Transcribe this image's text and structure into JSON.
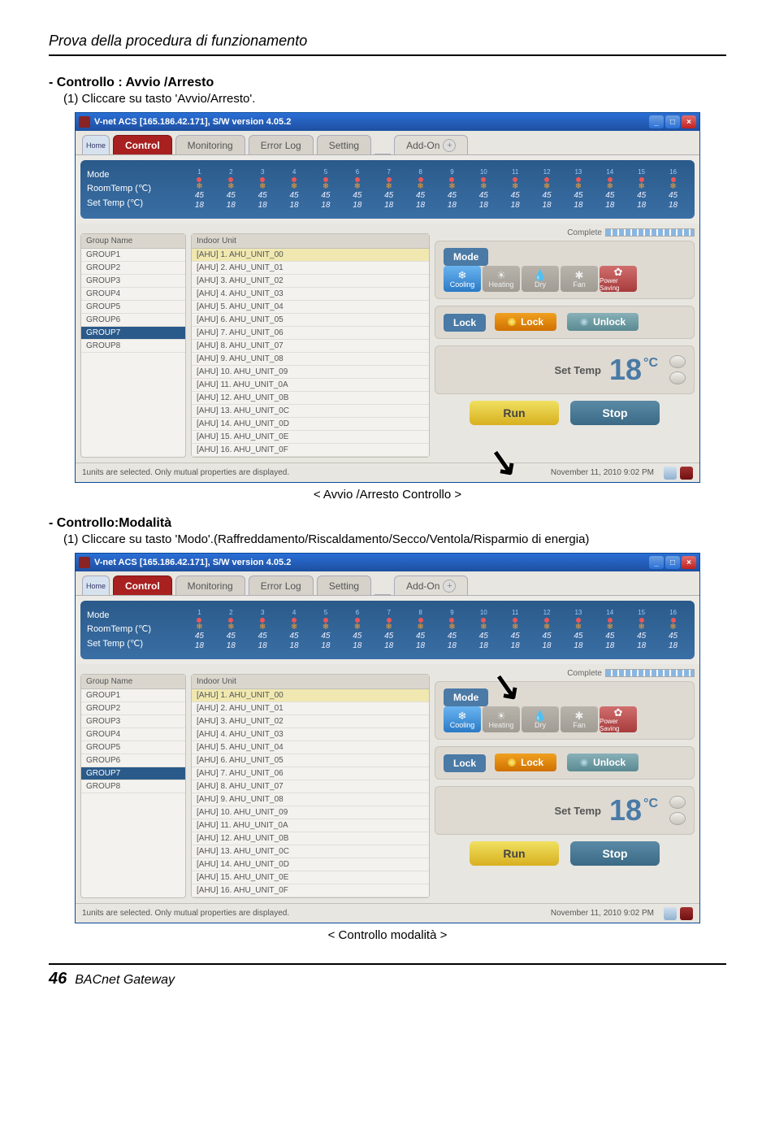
{
  "header": {
    "section": "Prova della procedura di funzionamento"
  },
  "sec1": {
    "title": "- Controllo : Avvio /Arresto",
    "step": "(1) Cliccare su tasto 'Avvio/Arresto'.",
    "caption": "< Avvio /Arresto Controllo >"
  },
  "sec2": {
    "title": "- Controllo:Modalità",
    "step": "(1) Cliccare su tasto 'Modo'.(Raffreddamento/Riscaldamento/Secco/Ventola/Risparmio di energia)",
    "caption": "< Controllo modalità >"
  },
  "win": {
    "title": "V-net ACS [165.186.42.171],   S/W version 4.05.2",
    "minimize": "_",
    "maximize": "□",
    "close": "×",
    "tabs": {
      "home": "Home",
      "control": "Control",
      "monitoring": "Monitoring",
      "errorlog": "Error Log",
      "setting": "Setting",
      "addon": "Add-On"
    },
    "hdr": {
      "mode": "Mode",
      "roomtemp": "RoomTemp (℃)",
      "settemp": "Set Temp  (℃)",
      "cols": [
        "1",
        "2",
        "3",
        "4",
        "5",
        "6",
        "7",
        "8",
        "9",
        "10",
        "11",
        "12",
        "13",
        "14",
        "15",
        "16"
      ],
      "v1": "45",
      "v2": "18"
    },
    "grouphdr": "Group Name",
    "groups": [
      "GROUP1",
      "GROUP2",
      "GROUP3",
      "GROUP4",
      "GROUP5",
      "GROUP6",
      "GROUP7",
      "GROUP8"
    ],
    "unithdr": "Indoor Unit",
    "units": [
      "[AHU] 1. AHU_UNIT_00",
      "[AHU] 2. AHU_UNIT_01",
      "[AHU] 3. AHU_UNIT_02",
      "[AHU] 4. AHU_UNIT_03",
      "[AHU] 5. AHU_UNIT_04",
      "[AHU] 6. AHU_UNIT_05",
      "[AHU] 7. AHU_UNIT_06",
      "[AHU] 8. AHU_UNIT_07",
      "[AHU] 9. AHU_UNIT_08",
      "[AHU] 10. AHU_UNIT_09",
      "[AHU] 11. AHU_UNIT_0A",
      "[AHU] 12. AHU_UNIT_0B",
      "[AHU] 13. AHU_UNIT_0C",
      "[AHU] 14. AHU_UNIT_0D",
      "[AHU] 15. AHU_UNIT_0E",
      "[AHU] 16. AHU_UNIT_0F"
    ],
    "complete": "Complete",
    "mode_label": "Mode",
    "modes": {
      "cooling": "Cooling",
      "heating": "Heating",
      "dry": "Dry",
      "fan": "Fan",
      "power": "Power Saving"
    },
    "lock_label": "Lock",
    "lock_btn": "Lock",
    "unlock_btn": "Unlock",
    "settemp_label": "Set Temp",
    "settemp_val": "18",
    "settemp_unit": "°C",
    "run": "Run",
    "stop": "Stop",
    "status_left": "1units are selected. Only mutual properties are displayed.",
    "status_right": "November 11, 2010  9:02 PM"
  },
  "footer": {
    "page": "46",
    "book": "BACnet Gateway"
  }
}
